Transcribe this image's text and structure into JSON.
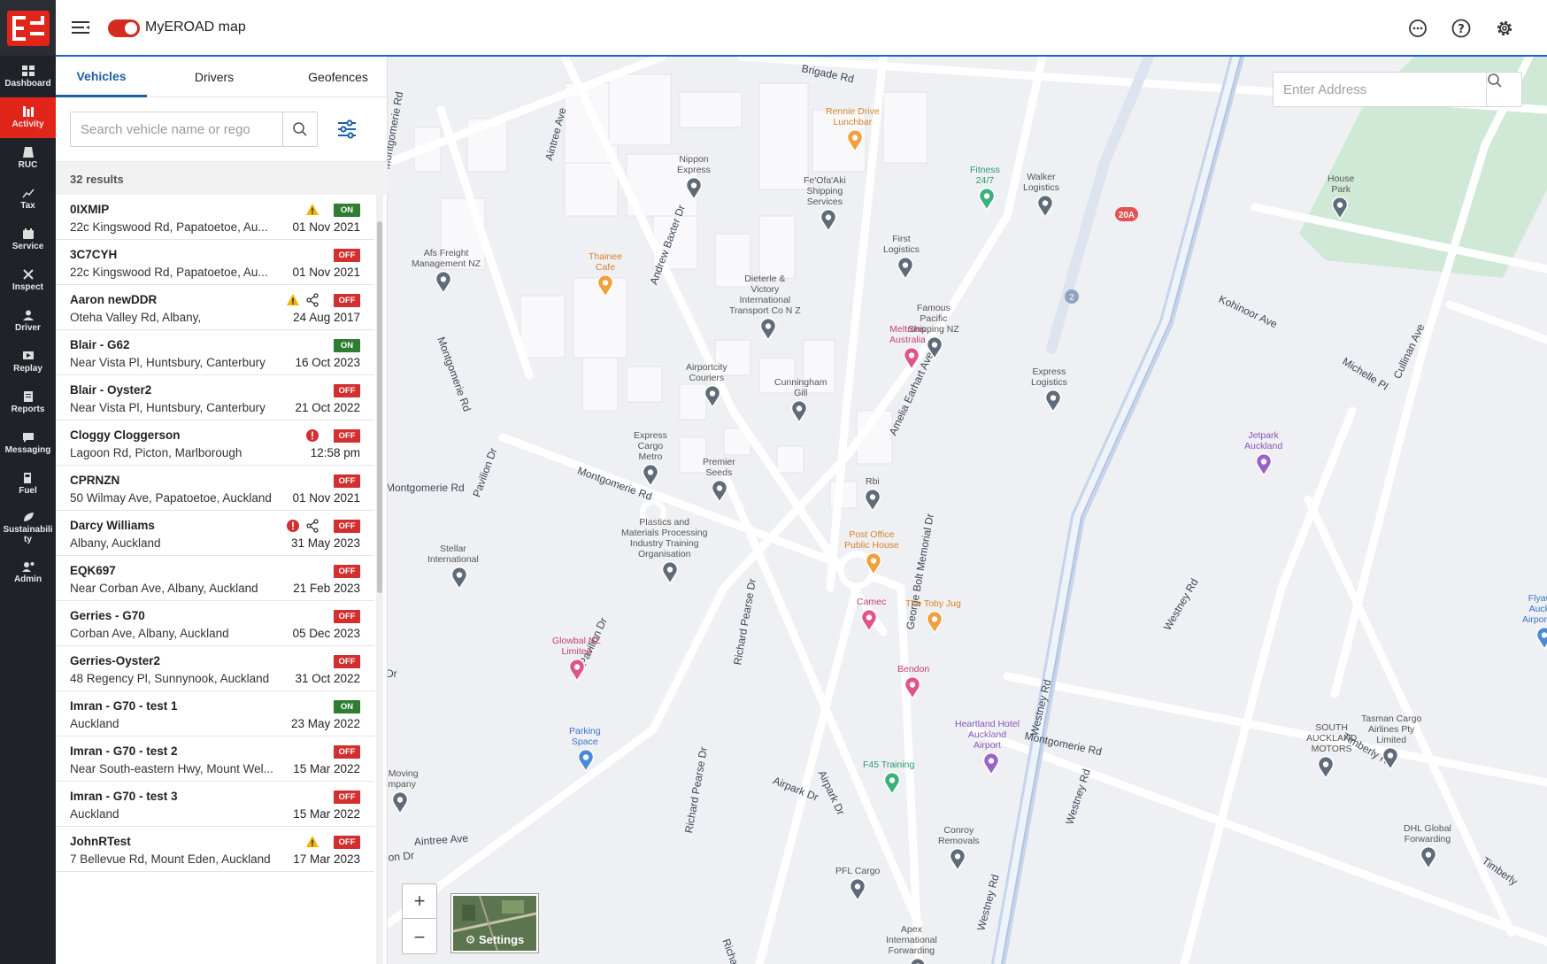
{
  "app": {
    "title": "MyEROAD map",
    "map_toggle_on": true
  },
  "rail": {
    "items": [
      {
        "label": "Dashboard",
        "icon": "dashboard-icon",
        "active": false
      },
      {
        "label": "Activity",
        "icon": "activity-icon",
        "active": true
      },
      {
        "label": "RUC",
        "icon": "ruc-icon",
        "active": false
      },
      {
        "label": "Tax",
        "icon": "tax-icon",
        "active": false
      },
      {
        "label": "Service",
        "icon": "service-icon",
        "active": false
      },
      {
        "label": "Inspect",
        "icon": "inspect-icon",
        "active": false
      },
      {
        "label": "Driver",
        "icon": "driver-icon",
        "active": false
      },
      {
        "label": "Replay",
        "icon": "replay-icon",
        "active": false
      },
      {
        "label": "Reports",
        "icon": "reports-icon",
        "active": false
      },
      {
        "label": "Messaging",
        "icon": "messaging-icon",
        "active": false
      },
      {
        "label": "Fuel",
        "icon": "fuel-icon",
        "active": false
      },
      {
        "label": "Sustainabili ty",
        "icon": "sustainability-icon",
        "active": false
      },
      {
        "label": "Admin",
        "icon": "admin-icon",
        "active": false
      }
    ]
  },
  "tabs": [
    {
      "label": "Vehicles",
      "active": true
    },
    {
      "label": "Drivers",
      "active": false
    },
    {
      "label": "Geofences",
      "active": false
    }
  ],
  "search": {
    "placeholder": "Search vehicle name or rego",
    "value": ""
  },
  "results": {
    "text": "32 results"
  },
  "vehicles": [
    {
      "name": "0IXMIP",
      "address": "22c Kingswood Rd, Papatoetoe, Au...",
      "date": "01 Nov 2021",
      "status": "ON",
      "warning": true,
      "alert": false,
      "shared": false
    },
    {
      "name": "3C7CYH",
      "address": "22c Kingswood Rd, Papatoetoe, Au...",
      "date": "01 Nov 2021",
      "status": "OFF",
      "warning": false,
      "alert": false,
      "shared": false
    },
    {
      "name": "Aaron newDDR",
      "address": "Oteha Valley Rd, Albany,",
      "date": "24 Aug 2017",
      "status": "OFF",
      "warning": true,
      "alert": false,
      "shared": true
    },
    {
      "name": "Blair - G62",
      "address": "Near Vista Pl, Huntsbury, Canterbury",
      "date": "16 Oct 2023",
      "status": "ON",
      "warning": false,
      "alert": false,
      "shared": false
    },
    {
      "name": "Blair - Oyster2",
      "address": "Near Vista Pl, Huntsbury, Canterbury",
      "date": "21 Oct 2022",
      "status": "OFF",
      "warning": false,
      "alert": false,
      "shared": false
    },
    {
      "name": "Cloggy Cloggerson",
      "address": "Lagoon Rd, Picton, Marlborough",
      "date": "12:58 pm",
      "status": "OFF",
      "warning": false,
      "alert": true,
      "shared": false
    },
    {
      "name": "CPRNZN",
      "address": "50 Wilmay Ave, Papatoetoe, Auckland",
      "date": "01 Nov 2021",
      "status": "OFF",
      "warning": false,
      "alert": false,
      "shared": false
    },
    {
      "name": "Darcy Williams",
      "address": "Albany, Auckland",
      "date": "31 May 2023",
      "status": "OFF",
      "warning": false,
      "alert": true,
      "shared": true
    },
    {
      "name": "EQK697",
      "address": "Near Corban Ave, Albany, Auckland",
      "date": "21 Feb 2023",
      "status": "OFF",
      "warning": false,
      "alert": false,
      "shared": false
    },
    {
      "name": "Gerries - G70",
      "address": "Corban Ave, Albany, Auckland",
      "date": "05 Dec 2023",
      "status": "OFF",
      "warning": false,
      "alert": false,
      "shared": false
    },
    {
      "name": "Gerries-Oyster2",
      "address": "48 Regency Pl, Sunnynook, Auckland",
      "date": "31 Oct 2022",
      "status": "OFF",
      "warning": false,
      "alert": false,
      "shared": false
    },
    {
      "name": "Imran - G70 - test 1",
      "address": "Auckland",
      "date": "23 May 2022",
      "status": "ON",
      "warning": false,
      "alert": false,
      "shared": false
    },
    {
      "name": "Imran - G70 - test 2",
      "address": "Near South-eastern Hwy, Mount Wel...",
      "date": "15 Mar 2022",
      "status": "OFF",
      "warning": false,
      "alert": false,
      "shared": false
    },
    {
      "name": "Imran - G70 - test 3",
      "address": "Auckland",
      "date": "15 Mar 2022",
      "status": "OFF",
      "warning": false,
      "alert": false,
      "shared": false
    },
    {
      "name": "JohnRTest",
      "address": "7 Bellevue Rd, Mount Eden, Auckland",
      "date": "17 Mar 2023",
      "status": "OFF",
      "warning": true,
      "alert": false,
      "shared": false
    }
  ],
  "map": {
    "address_search": {
      "placeholder": "Enter Address",
      "value": ""
    },
    "zoom_in": "+",
    "zoom_out": "−",
    "layers_label": "⚙ Settings",
    "places": [
      {
        "text": "Rennie Drive\nLunchbar",
        "kind": "orange"
      },
      {
        "text": "Nippon\nExpress",
        "kind": "grey"
      },
      {
        "text": "Fe'Ofa'Aki\nShipping\nServices",
        "kind": "grey"
      },
      {
        "text": "Fitness\n24/7",
        "kind": "green"
      },
      {
        "text": "Walker\nLogistics",
        "kind": "grey"
      },
      {
        "text": "House\nPark",
        "kind": "grey"
      },
      {
        "text": "Afs Freight\nManagement NZ",
        "kind": "grey"
      },
      {
        "text": "Thainee\nCafe",
        "kind": "orange"
      },
      {
        "text": "Dieterle &\nVictory\nInternational\nTransport Co N Z",
        "kind": "grey"
      },
      {
        "text": "First\nLogistics",
        "kind": "grey"
      },
      {
        "text": "Meltrons\nAustralia",
        "kind": "pink"
      },
      {
        "text": "Famous\nPacific\nShipping NZ",
        "kind": "grey"
      },
      {
        "text": "Airportcity\nCouriers",
        "kind": "grey"
      },
      {
        "text": "Cunningham\nGill",
        "kind": "grey"
      },
      {
        "text": "Express\nLogistics",
        "kind": "grey"
      },
      {
        "text": "Jetpark\nAuckland",
        "kind": "purple"
      },
      {
        "text": "Express\nCargo\nMetro",
        "kind": "grey"
      },
      {
        "text": "Premier\nSeeds",
        "kind": "grey"
      },
      {
        "text": "Rbi",
        "kind": "grey"
      },
      {
        "text": "Plastics and\nMaterials Processing\nIndustry Training\nOrganisation",
        "kind": "grey"
      },
      {
        "text": "Post Office\nPublic House",
        "kind": "orange"
      },
      {
        "text": "Stellar\nInternational",
        "kind": "grey"
      },
      {
        "text": "Camec",
        "kind": "pink"
      },
      {
        "text": "The Toby Jug",
        "kind": "orange"
      },
      {
        "text": "Glowbal NZ\nLimited",
        "kind": "pink"
      },
      {
        "text": "Bendon",
        "kind": "pink"
      },
      {
        "text": "Heartland Hotel\nAuckland\nAirport",
        "kind": "purple"
      },
      {
        "text": "Parking\nSpace",
        "kind": "blue"
      },
      {
        "text": "F45 Training",
        "kind": "green"
      },
      {
        "text": "SOUTH\nAUCKLAND\nMOTORS",
        "kind": "grey"
      },
      {
        "text": "Tasman Cargo\nAirlines Pty\nLimited",
        "kind": "grey"
      },
      {
        "text": "DHL Global\nForwarding",
        "kind": "grey"
      },
      {
        "text": "Conroy\nRemovals",
        "kind": "grey"
      },
      {
        "text": "PFL Cargo",
        "kind": "grey"
      },
      {
        "text": "Apex\nInternational\nForwarding",
        "kind": "grey"
      },
      {
        "text": "e Moving\nompany",
        "kind": "grey"
      },
      {
        "text": "Flyaw\nAuckl\nAirport P",
        "kind": "blue"
      }
    ],
    "streets": [
      "Brigade Rd",
      "Aintree Ave",
      "Montgomerie Rd",
      "Andrew Baxter Dr",
      "Montgomerie Rd",
      "Kohinoor Ave",
      "Michelle Pl",
      "Cullinan Ave",
      "Amelia Earhart Ave",
      "Montgomerie Rd",
      "Pavilion Dr",
      "Pavilion Dr",
      "Richard Pearse Dr",
      "George Bolt Memorial Dr",
      "Westney Rd",
      "Montgomerie Rd",
      "Airpark Dr",
      "Airpark Dr",
      "Richard Pearse Dr",
      "Timberly Rd",
      "Westney Rd",
      "Timberly",
      "Westney Rd",
      "Westney Rd",
      "ion Dr",
      "Dr",
      "Richard Pea",
      "Aintree Ave",
      "Montgomerie Rd"
    ],
    "badges": {
      "route_label": "20A",
      "motorway_label": "2"
    }
  }
}
